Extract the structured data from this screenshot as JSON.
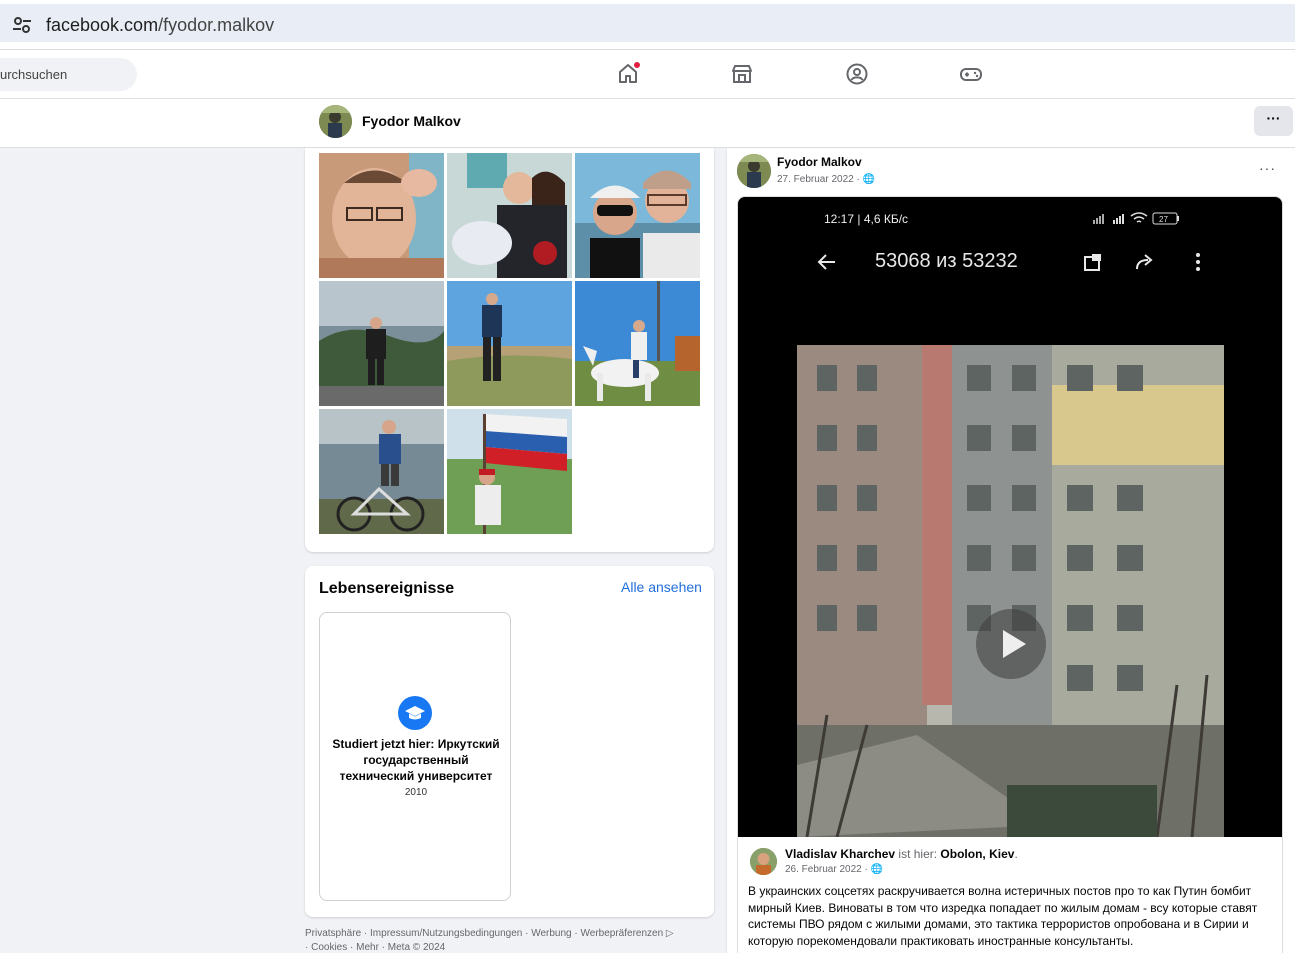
{
  "browser": {
    "url_domain": "facebook.com",
    "url_path": "/fyodor.malkov"
  },
  "nav": {
    "search_placeholder": "urchsuchen",
    "icons": [
      "home-icon",
      "marketplace-icon",
      "groups-icon",
      "gaming-icon"
    ],
    "home_notification": true
  },
  "profile": {
    "name": "Fyodor Malkov",
    "more_label": "···"
  },
  "photos": {
    "items": [
      "photo-1",
      "photo-2",
      "photo-3",
      "photo-4",
      "photo-5",
      "photo-6",
      "photo-7",
      "photo-8"
    ]
  },
  "life_events": {
    "title": "Lebensereignisse",
    "see_all": "Alle ansehen",
    "event_text": "Studiert jetzt hier: Иркутский государственный технический университет",
    "event_year": "2010",
    "event_icon": "graduation-cap-icon"
  },
  "footer": {
    "line1": "Privatsphäre · Impressum/Nutzungsbedingungen · Werbung · Werbepräferenzen ▷",
    "line2": "· Cookies · Mehr · Meta © 2024"
  },
  "post": {
    "author": "Fyodor Malkov",
    "date": "27. Februar 2022 · 🌐",
    "menu": "···",
    "video": {
      "status_time": "12:17 | 4,6 КБ/с",
      "battery": "27",
      "counter": "53068 из 53232"
    },
    "shared": {
      "author": "Vladislav Kharchev",
      "is_here": " ist hier: ",
      "place": "Obolon, Kiev",
      "period": ".",
      "date": "26. Februar 2022 · 🌐",
      "text": "В украинских соцсетях раскручивается волна истеричных постов про то как Путин бомбит мирный Киев. Виноваты в том что изредка попадает по жилым домам - всу которые ставят системы ПВО рядом с жилыми домами, это тактика террористов опробована и в Сирии и которую порекомендовали практиковать иностранные консультанты."
    }
  },
  "colors": {
    "accent": "#1877f2",
    "link": "#216fdb",
    "notification": "#e41e3f"
  }
}
